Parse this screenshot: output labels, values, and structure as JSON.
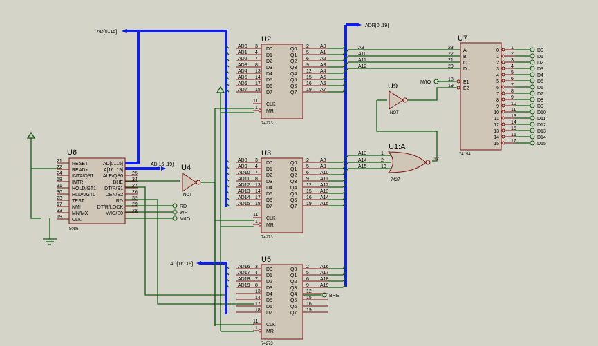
{
  "labels": {
    "ad_bus_top": "AD[0..15]",
    "adr_bus": "ADR[0..19]",
    "ad_hi_mid": "AD[16..19]",
    "ad_hi_low": "AD[16..19]",
    "mio": "M/IO",
    "rd": "RD",
    "wr": "WR",
    "mio2": "M/IO",
    "bhe": "BHE"
  },
  "u2": {
    "ref": "U2",
    "sub": "74273",
    "in_pins": [
      "3",
      "4",
      "7",
      "8",
      "13",
      "14",
      "17",
      "18"
    ],
    "out_pins": [
      "2",
      "5",
      "6",
      "9",
      "12",
      "15",
      "16",
      "19"
    ],
    "clk_pin": "11",
    "mr_pin": "1",
    "in_nets": [
      "AD0",
      "AD1",
      "AD2",
      "AD3",
      "AD4",
      "AD5",
      "AD6",
      "AD7"
    ],
    "out_nets": [
      "A0",
      "A1",
      "A2",
      "A3",
      "A4",
      "A5",
      "A6",
      "A7"
    ],
    "inner_in": [
      "D0",
      "D1",
      "D2",
      "D3",
      "D4",
      "D5",
      "D6",
      "D7"
    ],
    "inner_out": [
      "Q0",
      "Q1",
      "Q2",
      "Q3",
      "Q4",
      "Q5",
      "Q6",
      "Q7"
    ],
    "clk": "CLK",
    "mr": "MR"
  },
  "u3": {
    "ref": "U3",
    "sub": "74273",
    "in_pins": [
      "3",
      "4",
      "7",
      "8",
      "13",
      "14",
      "17",
      "18"
    ],
    "out_pins": [
      "2",
      "5",
      "6",
      "9",
      "12",
      "15",
      "16",
      "19"
    ],
    "clk_pin": "11",
    "mr_pin": "1",
    "in_nets": [
      "AD8",
      "AD9",
      "AD10",
      "AD11",
      "AD12",
      "AD13",
      "AD14",
      "AD15"
    ],
    "out_nets": [
      "A8",
      "A9",
      "A10",
      "A11",
      "A12",
      "A13",
      "A14",
      "A15"
    ],
    "inner_in": [
      "D0",
      "D1",
      "D2",
      "D3",
      "D4",
      "D5",
      "D6",
      "D7"
    ],
    "inner_out": [
      "Q0",
      "Q1",
      "Q2",
      "Q3",
      "Q4",
      "Q5",
      "Q6",
      "Q7"
    ],
    "clk": "CLK",
    "mr": "MR"
  },
  "u5": {
    "ref": "U5",
    "sub": "74273",
    "in_pins": [
      "3",
      "4",
      "7",
      "8",
      "13",
      "14",
      "17",
      "18"
    ],
    "out_pins": [
      "2",
      "5",
      "6",
      "9",
      "12",
      "15",
      "16",
      "19"
    ],
    "clk_pin": "11",
    "mr_pin": "1",
    "in_nets": [
      "AD16",
      "AD17",
      "AD18",
      "AD19",
      "",
      "",
      "",
      ""
    ],
    "out_nets": [
      "A16",
      "A17",
      "A18",
      "A19",
      "",
      "",
      "",
      ""
    ],
    "inner_in": [
      "D0",
      "D1",
      "D2",
      "D3",
      "D4",
      "D5",
      "D6",
      "D7"
    ],
    "inner_out": [
      "Q0",
      "Q1",
      "Q2",
      "Q3",
      "Q4",
      "Q5",
      "Q6",
      "Q7"
    ],
    "clk": "CLK",
    "mr": "MR"
  },
  "u6": {
    "ref": "U6",
    "sub": "8086",
    "left_pins": [
      "21",
      "22",
      "24",
      "18",
      "31",
      "30",
      "23",
      "17",
      "33",
      "19"
    ],
    "left_names": [
      "RESET",
      "READY",
      "INTA/QS1",
      "INTR",
      "HOLD/GT1",
      "HLDA/GT0",
      "TEST",
      "NMI",
      "MN/MX",
      "CLK"
    ],
    "right_names": [
      "AD[0..15]",
      "A[16..19]",
      "ALE/QS0",
      "BHE",
      "DT/R/S1",
      "DEN/S2",
      "RD",
      "DT/R/LOCK",
      "M/IO/S0"
    ],
    "right_pins": [
      "",
      "",
      "25",
      "34",
      "27",
      "26",
      "32",
      "29",
      "28"
    ]
  },
  "u4": {
    "ref": "U4",
    "sub": "NOT"
  },
  "u9": {
    "ref": "U9",
    "sub": "NOT"
  },
  "u1": {
    "ref": "U1:A",
    "sub": "7427",
    "in_pins": [
      "1",
      "2",
      "13"
    ],
    "out_pin": "12",
    "in_nets": [
      "A13",
      "A14",
      "A15"
    ]
  },
  "u7": {
    "ref": "U7",
    "sub": "74154",
    "in_pins": [
      "23",
      "22",
      "21",
      "20"
    ],
    "in_names": [
      "A",
      "B",
      "C",
      "D"
    ],
    "in_nets": [
      "A9",
      "A10",
      "A11",
      "A12"
    ],
    "en_pins": [
      "18",
      "19"
    ],
    "en_names": [
      "E1",
      "E2"
    ],
    "out_nums": [
      "0",
      "1",
      "2",
      "3",
      "4",
      "5",
      "6",
      "7",
      "8",
      "9",
      "10",
      "11",
      "12",
      "13",
      "14",
      "15"
    ],
    "out_pins": [
      "1",
      "2",
      "3",
      "4",
      "5",
      "6",
      "7",
      "8",
      "9",
      "10",
      "11",
      "13",
      "14",
      "15",
      "16",
      "17"
    ],
    "out_nets": [
      "D0",
      "D1",
      "D2",
      "D3",
      "D4",
      "D5",
      "D6",
      "D7",
      "D8",
      "D9",
      "D10",
      "D11",
      "D12",
      "D13",
      "D14",
      "D15"
    ]
  }
}
